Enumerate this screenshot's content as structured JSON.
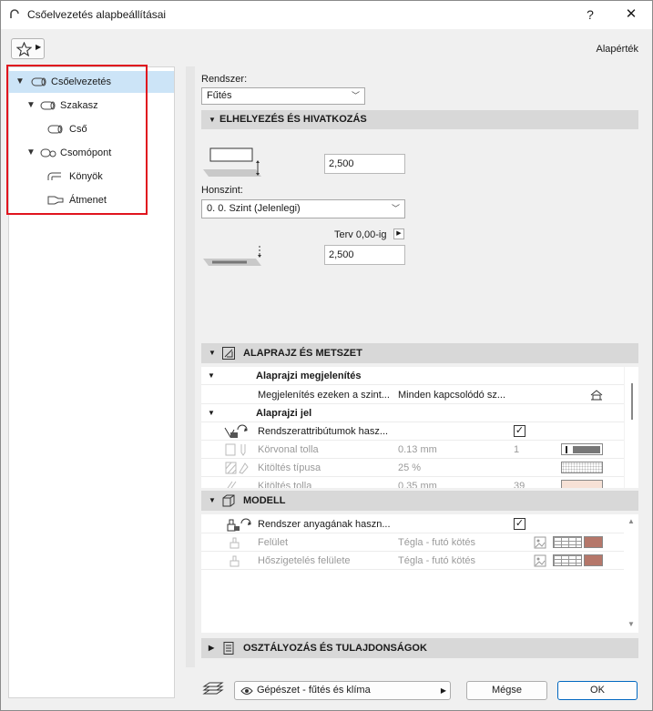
{
  "window": {
    "title": "Csőelvezetés alapbeállításai",
    "help_glyph": "?",
    "close_glyph": "✕"
  },
  "toolbar": {
    "favorites_icon": "star-icon",
    "default_label": "Alapérték"
  },
  "tree": {
    "items": [
      {
        "label": "Csőelvezetés"
      },
      {
        "label": "Szakasz"
      },
      {
        "label": "Cső"
      },
      {
        "label": "Csomópont"
      },
      {
        "label": "Könyök"
      },
      {
        "label": "Átmenet"
      }
    ]
  },
  "system": {
    "label": "Rendszer:",
    "value": "Fűtés"
  },
  "placement": {
    "header": "ELHELYEZÉS ÉS HIVATKOZÁS",
    "top_value": "2,500",
    "home_story_label": "Honszint:",
    "home_story_value": "0. 0. Szint (Jelenlegi)",
    "ref_label": "Terv 0,00-ig",
    "bottom_value": "2,500"
  },
  "floorplan": {
    "header": "ALAPRAJZ ÉS METSZET",
    "group1": "Alaprajzi megjelenítés",
    "row_show_name": "Megjelenítés ezeken a szint...",
    "row_show_value": "Minden kapcsolódó sz...",
    "group2": "Alaprajzi jel",
    "row_sys_attr": "Rendszerattribútumok hasz...",
    "row_sys_attr_check": "✓",
    "row_pen_name": "Körvonal tolla",
    "row_pen_value": "0.13 mm",
    "row_pen_num": "1",
    "row_fill_name": "Kitöltés típusa",
    "row_fill_value": "25 %",
    "row_fillpen_name": "Kitöltés tolla",
    "row_fillpen_value": "0.35 mm",
    "row_fillpen_num": "39"
  },
  "model": {
    "header": "MODELL",
    "row_sys_mat": "Rendszer anyagának haszn...",
    "row_sys_mat_check": "✓",
    "row_surface_name": "Felület",
    "row_surface_value": "Tégla - futó kötés",
    "row_insul_name": "Hőszigetelés felülete",
    "row_insul_value": "Tégla - futó kötés"
  },
  "classification": {
    "header": "OSZTÁLYOZÁS ÉS TULAJDONSÁGOK"
  },
  "footer": {
    "layer_value": "Gépészet - fűtés és klíma",
    "cancel_label": "Mégse",
    "ok_label": "OK"
  },
  "colors": {
    "accent": "#0067c0",
    "selection": "#cce4f7",
    "highlight_box": "#e0141e",
    "brick": "#b5776a"
  }
}
